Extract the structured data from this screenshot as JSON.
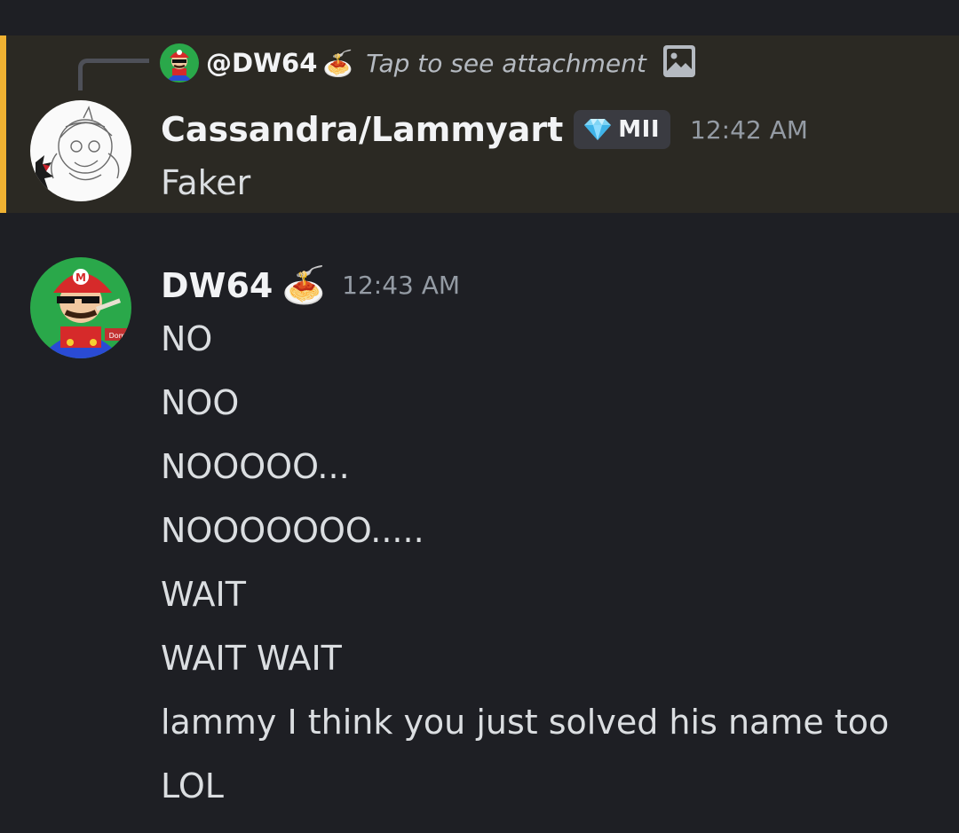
{
  "reply_preview": {
    "author": "@DW64",
    "author_emoji": "🍝",
    "text": "Tap to see attachment",
    "attachment_icon": "image-icon"
  },
  "messages": [
    {
      "author": "Cassandra/Lammyart",
      "role_badge": {
        "icon": "diamond-icon",
        "label": "MII"
      },
      "timestamp": "12:42 AM",
      "lines": [
        "Faker"
      ],
      "highlighted": true,
      "highlight_color": "#f0b232"
    },
    {
      "author": "DW64",
      "author_emoji": "🍝",
      "timestamp": "12:43 AM",
      "lines": [
        "NO",
        "NOO",
        "NOOOOO...",
        "NOOOOOOO.....",
        "WAIT",
        "WAIT WAIT",
        "lammy I think you just solved his name too",
        "LOL"
      ]
    }
  ],
  "colors": {
    "background": "#1e1f24",
    "mention_background": "#2b2923",
    "name": "#f2f3f5",
    "text": "#dbdee1",
    "timestamp": "#949ba4"
  }
}
